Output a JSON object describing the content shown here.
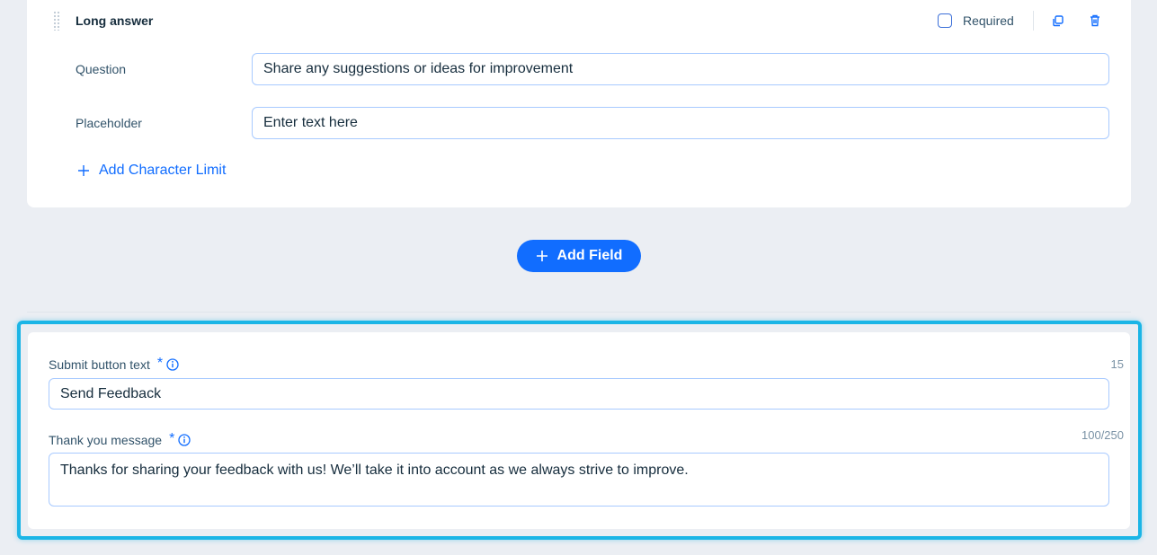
{
  "field": {
    "type_label": "Long answer",
    "required_label": "Required",
    "required_checked": false,
    "question_label": "Question",
    "question_value": "Share any suggestions or ideas for improvement",
    "placeholder_label": "Placeholder",
    "placeholder_value": "Enter text here",
    "add_limit_label": "Add Character Limit"
  },
  "add_field_label": "Add Field",
  "submit": {
    "button_text_label": "Submit button text",
    "button_text_value": "Send Feedback",
    "button_text_counter": "15",
    "thank_you_label": "Thank you message",
    "thank_you_value": "Thanks for sharing your feedback with us! We’ll take it into account as we always strive to improve.",
    "thank_you_counter": "100/250",
    "required_mark": "*"
  },
  "colors": {
    "accent": "#116dff",
    "highlight": "#1bb5e6",
    "background": "#ebeef3"
  },
  "icons": [
    "drag-handle-icon",
    "duplicate-icon",
    "trash-icon",
    "plus-icon",
    "info-icon"
  ]
}
